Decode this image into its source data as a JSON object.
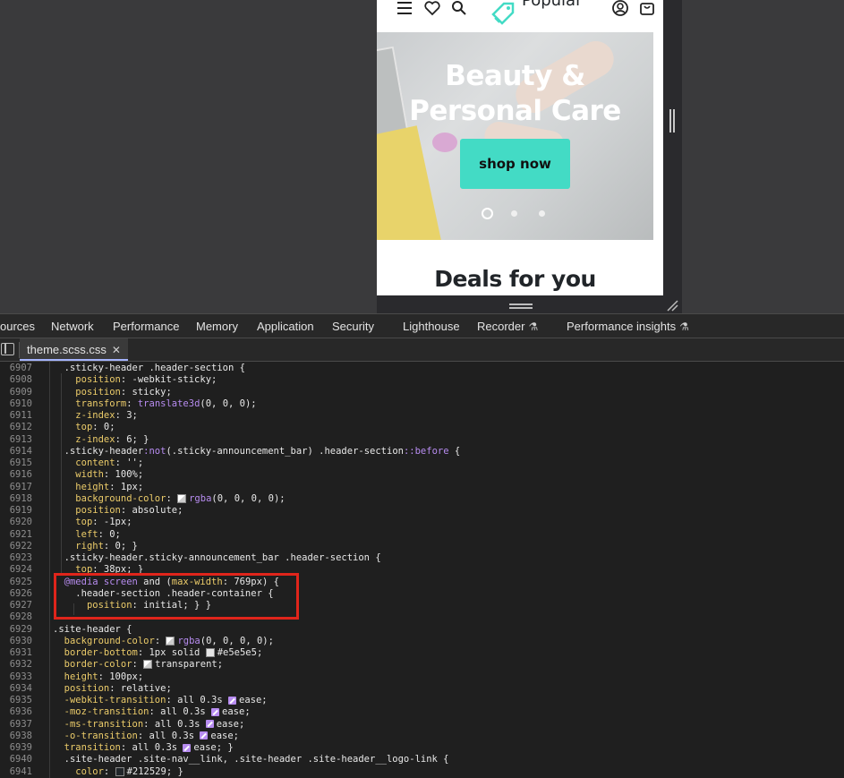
{
  "preview": {
    "logo_text": "Popular",
    "hero_title_line1": "Beauty &",
    "hero_title_line2": "Personal Care",
    "shop_button": "shop now",
    "section_heading": "Deals for you",
    "carousel_active_index": 0,
    "carousel_count": 3,
    "accent_color": "#43dbc5"
  },
  "devtools": {
    "tabs": [
      {
        "label": "ources",
        "active": true
      },
      {
        "label": "Network"
      },
      {
        "label": "Performance"
      },
      {
        "label": "Memory"
      },
      {
        "label": "Application"
      },
      {
        "label": "Security"
      },
      {
        "label": "Lighthouse"
      },
      {
        "label": "Recorder",
        "icon": "flask-icon"
      },
      {
        "label": "Performance insights",
        "icon": "flask-icon"
      }
    ],
    "open_file": "theme.scss.css",
    "close_glyph": "✕",
    "accent_color": "#a5b4fc",
    "highlight_color": "#e0251b"
  },
  "code": {
    "lines": [
      {
        "n": "6907",
        "text": "  .sticky-header .header-section {"
      },
      {
        "n": "6908",
        "text": "    position: -webkit-sticky;"
      },
      {
        "n": "6909",
        "text": "    position: sticky;"
      },
      {
        "n": "6910",
        "text": "    transform: translate3d(0, 0, 0);"
      },
      {
        "n": "6911",
        "text": "    z-index: 3;"
      },
      {
        "n": "6912",
        "text": "    top: 0;"
      },
      {
        "n": "6913",
        "text": "    z-index: 6; }"
      },
      {
        "n": "6914",
        "text": "  .sticky-header:not(.sticky-announcement_bar) .header-section::before {"
      },
      {
        "n": "6915",
        "text": "    content: '';"
      },
      {
        "n": "6916",
        "text": "    width: 100%;"
      },
      {
        "n": "6917",
        "text": "    height: 1px;"
      },
      {
        "n": "6918",
        "text": "    background-color: rgba(0, 0, 0, 0);"
      },
      {
        "n": "6919",
        "text": "    position: absolute;"
      },
      {
        "n": "6920",
        "text": "    top: -1px;"
      },
      {
        "n": "6921",
        "text": "    left: 0;"
      },
      {
        "n": "6922",
        "text": "    right: 0; }"
      },
      {
        "n": "6923",
        "text": "  .sticky-header.sticky-announcement_bar .header-section {"
      },
      {
        "n": "6924",
        "text": "    top: 38px; }"
      },
      {
        "n": "6925",
        "text": "  @media screen and (max-width: 769px) {"
      },
      {
        "n": "6926",
        "text": "    .header-section .header-container {"
      },
      {
        "n": "6927",
        "text": "      position: initial; } }"
      },
      {
        "n": "6928",
        "text": ""
      },
      {
        "n": "6929",
        "text": ".site-header {"
      },
      {
        "n": "6930",
        "text": "  background-color: rgba(0, 0, 0, 0);"
      },
      {
        "n": "6931",
        "text": "  border-bottom: 1px solid #e5e5e5;"
      },
      {
        "n": "6932",
        "text": "  border-color: transparent;"
      },
      {
        "n": "6933",
        "text": "  height: 100px;"
      },
      {
        "n": "6934",
        "text": "  position: relative;"
      },
      {
        "n": "6935",
        "text": "  -webkit-transition: all 0.3s ease;"
      },
      {
        "n": "6936",
        "text": "  -moz-transition: all 0.3s ease;"
      },
      {
        "n": "6937",
        "text": "  -ms-transition: all 0.3s ease;"
      },
      {
        "n": "6938",
        "text": "  -o-transition: all 0.3s ease;"
      },
      {
        "n": "6939",
        "text": "  transition: all 0.3s ease; }"
      },
      {
        "n": "6940",
        "text": "  .site-header .site-nav__link, .site-header .site-header__logo-link {"
      },
      {
        "n": "6941",
        "text": "    color: #212529; }"
      }
    ]
  }
}
